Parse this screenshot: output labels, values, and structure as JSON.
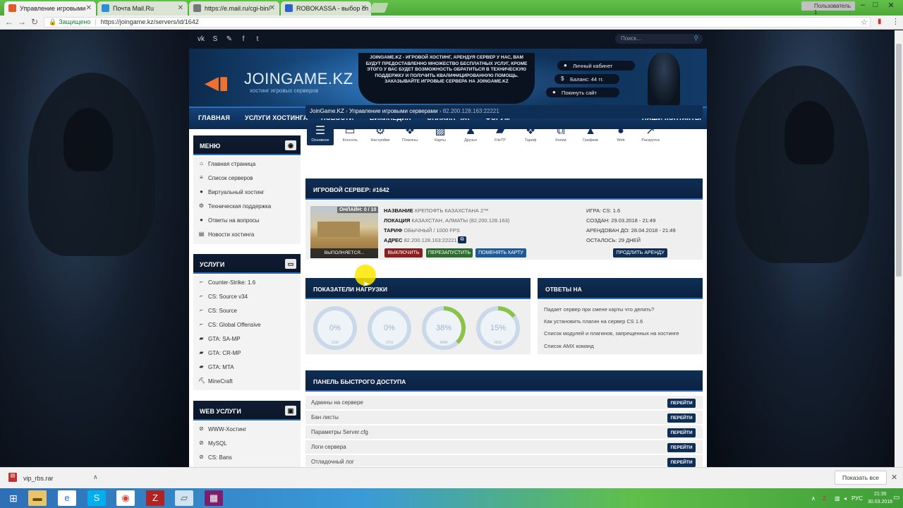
{
  "browser": {
    "tabs": [
      {
        "title": "Управление игровыми",
        "active": true
      },
      {
        "title": "Почта Mail.Ru",
        "active": false
      },
      {
        "title": "https://e.mail.ru/cgi-bin/",
        "active": false
      },
      {
        "title": "ROBOKASSA - выбор сп",
        "active": false
      }
    ],
    "user_badge": "Пользователь 1",
    "secure_label": "Защищено",
    "url": "https://joingame.kz/servers/id/1642"
  },
  "site": {
    "search_placeholder": "Поиск...",
    "logo": "JOINGAME.KZ",
    "logo_sub": "хостинг игровых серверов",
    "banner_text": "JOINGAME.KZ - ИГРОВОЙ ХОСТИНГ, АРЕНДУЯ СЕРВЕР У НАС, ВАМ БУДУТ ПРЕДОСТАВЛЕННО МНОЖЕСТВО БЕСПЛАТНЫХ УСЛУГ, КРОМЕ ЭТОГО У ВАС БУДЕТ ВОЗМОЖНОСТЬ ОБРАТИТЬСЯ В ТЕХНИЧЕСКУЮ ПОДДЕРЖКУ И ПОЛУЧИТЬ КВАЛИФИЦИРОВАННУЮ ПОМОЩЬ. ЗАКАЗЫВАЙТЕ ИГРОВЫЕ СЕРВЕРА НА JOINGAME.KZ",
    "account": {
      "cabinet": "Личный кабинет",
      "balance": "Баланс: 44 тг.",
      "logout": "Покинуть сайт"
    },
    "nav": [
      "ГЛАВНАЯ",
      "УСЛУГИ ХОСТИНГА",
      "НОВОСТИ",
      "ВИКИПЕДИЯ",
      "ОНЛАЙН-ЧАТ",
      "ФОРУМ",
      "НАШИ КОНТАКТЫ"
    ]
  },
  "sidebar": {
    "menu_title": "МЕНЮ",
    "menu": [
      "Главная страница",
      "Список серверов",
      "Виртуальный хостинг",
      "Техническая поддержка",
      "Ответы на вопросы",
      "Новости хостинга"
    ],
    "services_title": "УСЛУГИ",
    "services": [
      "Counter-Strike: 1.6",
      "CS: Source v34",
      "CS: Source",
      "CS: Global Offensive",
      "GTA: SA-MP",
      "GTA: CR-MP",
      "GTA: MTA",
      "MineCraft"
    ],
    "web_title": "WEB УСЛУГИ",
    "web": [
      "WWW-Хостинг",
      "MySQL",
      "CS: Bans"
    ]
  },
  "breadcrumb": {
    "a": "JoinGame.KZ",
    "b": "Управление игровыми серверами",
    "c": "82.200.128.163:22221"
  },
  "toolbar": [
    "Основное",
    "Консоль",
    "Настройки",
    "Плагины",
    "Карты",
    "Друзья",
    "FileTP",
    "Тариф",
    "Копии",
    "Графики",
    "Web",
    "Раскрутка"
  ],
  "server": {
    "title": "ИГРОВОЙ СЕРВЕР: #1642",
    "online": "ОНЛАЙН: 0 / 10",
    "status": "ВЫПОЛНЯЕТСЯ...",
    "name_label": "НАЗВАНИЕ",
    "name": "КРЕПОФТЬ КАЗАХСТАНА 2™",
    "loc_label": "ЛОКАЦИЯ",
    "loc": "КАЗАХСТАН, АЛМАТЫ (82.200.128.163)",
    "tariff_label": "ТАРИФ",
    "tariff": "ОБЫЧНЫЙ / 1000 FPS",
    "addr_label": "АДРЕС",
    "addr": "82.200.128.163:22221",
    "game": "ИГРА: CS: 1.6",
    "created": "СОЗДАН: 29.03.2018 - 21:49",
    "rented_until": "АРЕНДОВАН ДО: 28.04.2018 - 21:49",
    "left": "ОСТАЛОСЬ: 29 ДНЕЙ",
    "btn_off": "ВЫКЛЮЧИТЬ",
    "btn_restart": "ПЕРЕЗАПУСТИТЬ",
    "btn_map": "ПОМЕНЯТЬ КАРТУ",
    "btn_extend": "ПРОДЛИТЬ АРЕНДУ"
  },
  "load": {
    "title": "ПОКАЗАТЕЛИ НАГРУЗКИ",
    "gauges": [
      {
        "value": "0%",
        "label": "USR",
        "pct": 0
      },
      {
        "value": "0%",
        "label": "CPU",
        "pct": 0
      },
      {
        "value": "38%",
        "label": "RAM",
        "pct": 38
      },
      {
        "value": "15%",
        "label": "HDD",
        "pct": 15
      }
    ]
  },
  "faq": {
    "title": "ОТВЕТЫ НА",
    "items": [
      "Падает сервер при смене карты что делать?",
      "Как установить плагин на сервер CS 1.6",
      "Список модулей и плагинов, запрещенных на хостинге",
      "Список AMX команд"
    ]
  },
  "quick": {
    "title": "ПАНЕЛЬ БЫСТРОГО ДОСТУПА",
    "button": "ПЕРЕЙТИ",
    "rows": [
      "Админы на сервере",
      "Бан листы",
      "Параметры Server.cfg",
      "Логи сервера",
      "Отладочный лог"
    ]
  },
  "download": {
    "file": "vip_rbs.rar",
    "show_all": "Показать все"
  },
  "taskbar": {
    "lang": "РУС",
    "time": "21:35",
    "date": "30.03.2018"
  },
  "colors": {
    "accent": "#0f2e55",
    "danger": "#8b1f1f",
    "success": "#2e6b2e",
    "info": "#1f5a96"
  }
}
